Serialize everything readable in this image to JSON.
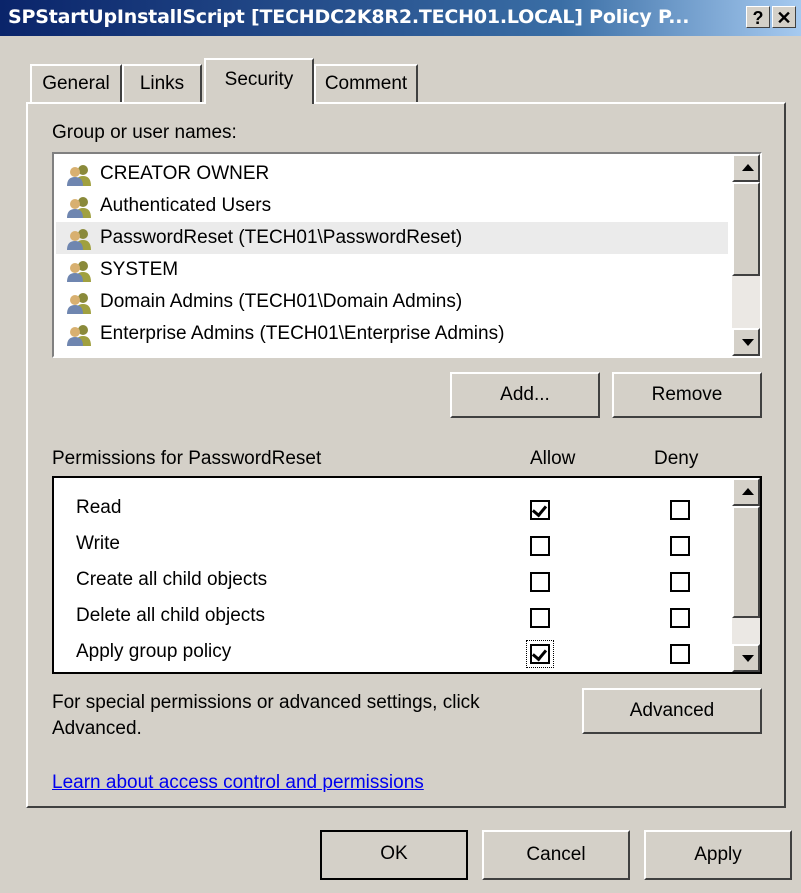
{
  "window": {
    "title": "SPStartUpInstallScript [TECHDC2K8R2.TECH01.LOCAL] Policy P...",
    "help_label": "?",
    "close_label": "✕"
  },
  "tabs": [
    {
      "label": "General"
    },
    {
      "label": "Links"
    },
    {
      "label": "Security"
    },
    {
      "label": "Comment"
    }
  ],
  "active_tab": "Security",
  "groups": {
    "label": "Group or user names:",
    "items": [
      {
        "name": "CREATOR OWNER"
      },
      {
        "name": "Authenticated Users"
      },
      {
        "name": "PasswordReset (TECH01\\PasswordReset)"
      },
      {
        "name": "SYSTEM"
      },
      {
        "name": "Domain Admins (TECH01\\Domain Admins)"
      },
      {
        "name": "Enterprise Admins (TECH01\\Enterprise Admins)"
      }
    ],
    "selected": "PasswordReset (TECH01\\PasswordReset)",
    "add_label": "Add...",
    "remove_label": "Remove"
  },
  "permissions": {
    "label": "Permissions for PasswordReset",
    "allow_header": "Allow",
    "deny_header": "Deny",
    "items": [
      {
        "name": "Read",
        "allow": true,
        "deny": false
      },
      {
        "name": "Write",
        "allow": false,
        "deny": false
      },
      {
        "name": "Create all child objects",
        "allow": false,
        "deny": false
      },
      {
        "name": "Delete all child objects",
        "allow": false,
        "deny": false
      },
      {
        "name": "Apply group policy",
        "allow": true,
        "deny": false
      }
    ]
  },
  "advanced": {
    "text_line1": "For special permissions or advanced settings, click",
    "text_line2": "Advanced.",
    "button_label": "Advanced"
  },
  "learn_link": "Learn about access control and permissions",
  "footer": {
    "ok_label": "OK",
    "cancel_label": "Cancel",
    "apply_label": "Apply"
  },
  "colors": {
    "title_start": "#0a246a",
    "title_end": "#a6caf0",
    "face": "#d4d0c8",
    "link": "#0000ee",
    "selection": "#ebebeb"
  },
  "icons": {
    "user_group": "users-icon"
  }
}
